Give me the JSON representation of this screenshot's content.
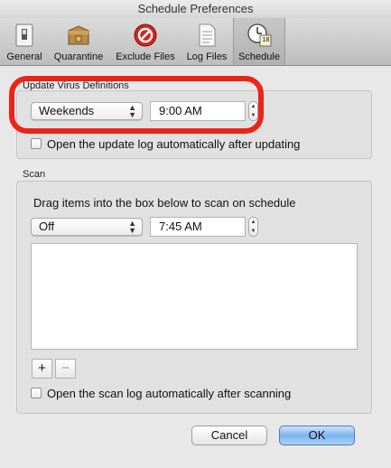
{
  "window": {
    "title": "Schedule Preferences"
  },
  "toolbar": {
    "items": [
      {
        "label": "General",
        "icon": "switch-icon",
        "selected": false
      },
      {
        "label": "Quarantine",
        "icon": "box-icon",
        "selected": false
      },
      {
        "label": "Exclude Files",
        "icon": "no-entry-icon",
        "selected": false
      },
      {
        "label": "Log Files",
        "icon": "document-icon",
        "selected": false
      },
      {
        "label": "Schedule",
        "icon": "clock-calendar-icon",
        "selected": true
      }
    ],
    "calendar_day": "18"
  },
  "update_section": {
    "label": "Update Virus Definitions",
    "frequency": "Weekends",
    "time": "9:00 AM",
    "open_log_label": "Open the update log automatically after updating",
    "open_log_checked": false
  },
  "scan_section": {
    "label": "Scan",
    "instructions": "Drag items into the box below to scan on schedule",
    "frequency": "Off",
    "time": "7:45 AM",
    "add_label": "+",
    "remove_label": "−",
    "open_log_label": "Open the scan log automatically after scanning",
    "open_log_checked": false
  },
  "buttons": {
    "cancel": "Cancel",
    "ok": "OK"
  },
  "colors": {
    "highlight": "#ec2418",
    "default_button": "#7fb3ef"
  }
}
